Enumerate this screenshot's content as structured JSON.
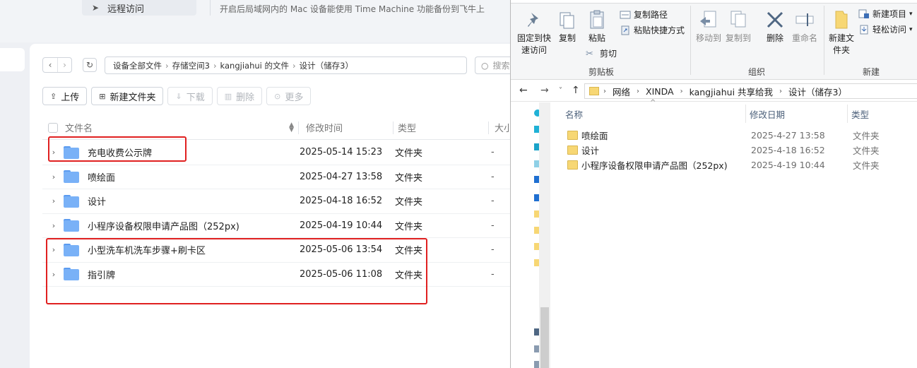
{
  "webapp": {
    "nav_remote_label": "远程访问",
    "hint_text": "开启后局域网内的 Mac 设备能使用 Time Machine 功能备份到飞牛上",
    "breadcrumb": [
      "设备全部文件",
      "存储空间3",
      "kangjiahui 的文件",
      "设计（储存3）"
    ],
    "search_placeholder": "搜索",
    "toolbar": {
      "upload": "上传",
      "new_folder": "新建文件夹",
      "download": "下载",
      "delete": "删除",
      "more": "更多"
    },
    "columns": {
      "name": "文件名",
      "mtime": "修改时间",
      "type": "类型",
      "size": "大小"
    },
    "rows": [
      {
        "name": "充电收费公示牌",
        "mtime": "2025-05-14 15:23",
        "type": "文件夹",
        "size": "-"
      },
      {
        "name": "喷绘面",
        "mtime": "2025-04-27 13:58",
        "type": "文件夹",
        "size": "-"
      },
      {
        "name": "设计",
        "mtime": "2025-04-18 16:52",
        "type": "文件夹",
        "size": "-"
      },
      {
        "name": "小程序设备权限申请产品图（252px)",
        "mtime": "2025-04-19 10:44",
        "type": "文件夹",
        "size": "-"
      },
      {
        "name": "小型洗车机洗车步骤+刷卡区",
        "mtime": "2025-05-06 13:54",
        "type": "文件夹",
        "size": "-"
      },
      {
        "name": "指引牌",
        "mtime": "2025-05-06 11:08",
        "type": "文件夹",
        "size": "-"
      }
    ],
    "highlight_color": "#e02020"
  },
  "explorer": {
    "ribbon": {
      "pin_quick_access": "固定到快速访问",
      "copy": "复制",
      "paste": "粘贴",
      "copy_path": "复制路径",
      "paste_shortcut": "粘贴快捷方式",
      "cut": "剪切",
      "clipboard_group": "剪贴板",
      "move_to": "移动到",
      "copy_to": "复制到",
      "delete": "删除",
      "rename": "重命名",
      "organize_group": "组织",
      "new_folder": "新建文件夹",
      "new_item": "新建项目",
      "easy_access": "轻松访问",
      "new_group": "新建"
    },
    "address": [
      "网络",
      "XINDA",
      "kangjiahui 共享给我",
      "设计（储存3）"
    ],
    "columns": {
      "name": "名称",
      "date": "修改日期",
      "type": "类型"
    },
    "rows": [
      {
        "name": "喷绘面",
        "date": "2025-4-27 13:58",
        "type": "文件夹"
      },
      {
        "name": "设计",
        "date": "2025-4-18 16:52",
        "type": "文件夹"
      },
      {
        "name": "小程序设备权限申请产品图（252px)",
        "date": "2025-4-19 10:44",
        "type": "文件夹"
      }
    ],
    "folder_color": "#f7d774"
  }
}
